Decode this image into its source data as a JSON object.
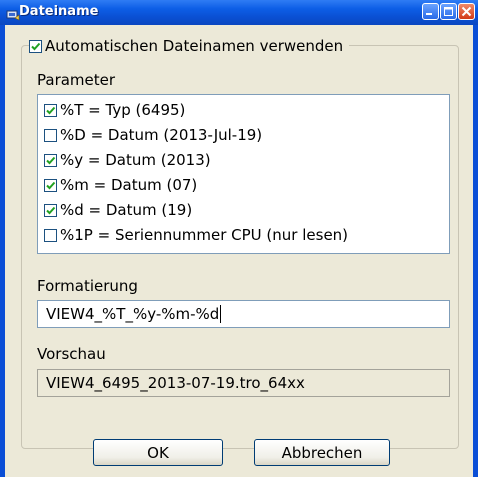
{
  "window": {
    "title": "Dateiname",
    "controls": [
      "minimize-icon",
      "maximize-icon",
      "close-icon"
    ]
  },
  "auto_filename": {
    "label": "Automatischen Dateinamen verwenden",
    "checked": true
  },
  "parameters": {
    "label": "Parameter",
    "items": [
      {
        "label": "%T = Typ (6495)",
        "checked": true
      },
      {
        "label": "%D = Datum (2013-Jul-19)",
        "checked": false
      },
      {
        "label": "%y = Datum (2013)",
        "checked": true
      },
      {
        "label": "%m = Datum (07)",
        "checked": true
      },
      {
        "label": "%d = Datum (19)",
        "checked": true
      },
      {
        "label": "%1P = Seriennummer CPU (nur lesen)",
        "checked": false
      }
    ]
  },
  "formatting": {
    "label": "Formatierung",
    "value": "VIEW4_%T_%y-%m-%d"
  },
  "preview": {
    "label": "Vorschau",
    "value": "VIEW4_6495_2013-07-19.tro_64xx"
  },
  "buttons": {
    "ok": "OK",
    "cancel": "Abbrechen"
  },
  "colors": {
    "titlebar": "#0a4fd2",
    "dialog_bg": "#ece9d8",
    "check": "#21a121",
    "list_border": "#7f9db9"
  }
}
